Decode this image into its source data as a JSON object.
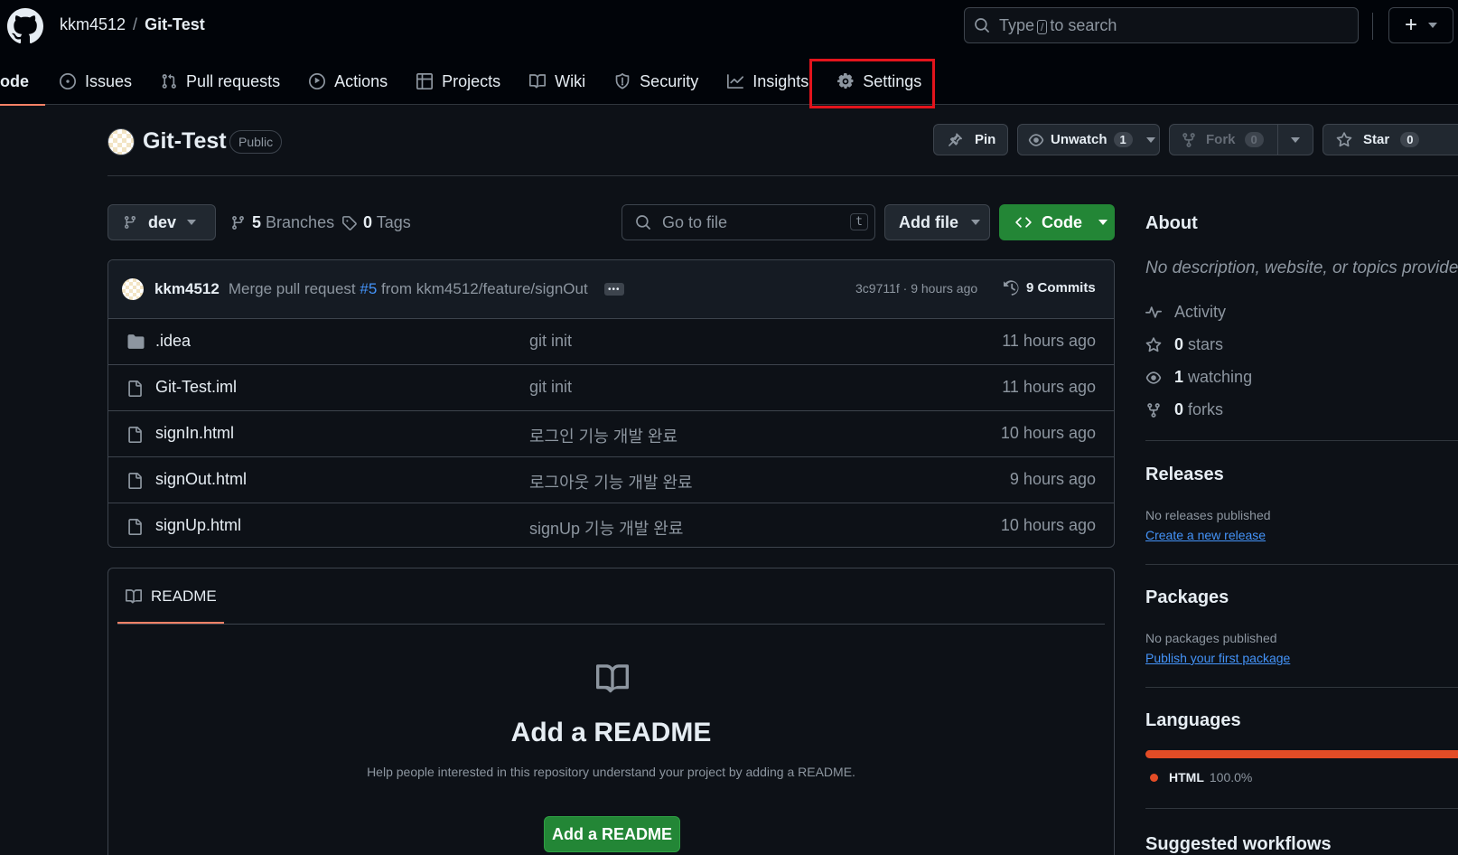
{
  "header": {
    "owner": "kkm4512",
    "separator": "/",
    "repo": "Git-Test",
    "search_pre": "Type",
    "search_key": "/",
    "search_post": "to search",
    "plus_label": "+"
  },
  "nav": {
    "code": "ode",
    "issues": "Issues",
    "pull_requests": "Pull requests",
    "actions": "Actions",
    "projects": "Projects",
    "wiki": "Wiki",
    "security": "Security",
    "insights": "Insights",
    "settings": "Settings"
  },
  "repo_header": {
    "name": "Git-Test",
    "visibility": "Public",
    "pin": "Pin",
    "unwatch": "Unwatch",
    "watch_count": "1",
    "fork": "Fork",
    "fork_count": "0",
    "star": "Star",
    "star_count": "0"
  },
  "file_nav": {
    "branch": "dev",
    "branches_count": "5",
    "branches_label": "Branches",
    "tags_count": "0",
    "tags_label": "Tags",
    "goto_placeholder": "Go to file",
    "goto_key": "t",
    "add_file": "Add file",
    "code": "Code"
  },
  "commit": {
    "author": "kkm4512",
    "msg_pre": "Merge pull request",
    "pr_ref": "#5",
    "msg_post": "from kkm4512/feature/signOut",
    "more": "•••",
    "meta": "3c9711f · 9 hours ago",
    "commits_count": "9",
    "commits_label": "Commits"
  },
  "files": [
    {
      "name": ".idea",
      "type": "folder",
      "message": "git init",
      "time": "11 hours ago"
    },
    {
      "name": "Git-Test.iml",
      "type": "file",
      "message": "git init",
      "time": "11 hours ago"
    },
    {
      "name": "signIn.html",
      "type": "file",
      "message": "로그인 기능 개발 완료",
      "time": "10 hours ago"
    },
    {
      "name": "signOut.html",
      "type": "file",
      "message": "로그아웃 기능 개발 완료",
      "time": "9 hours ago"
    },
    {
      "name": "signUp.html",
      "type": "file",
      "message": "signUp 기능 개발 완료",
      "time": "10 hours ago"
    }
  ],
  "readme": {
    "tab": "README",
    "heading": "Add a README",
    "desc": "Help people interested in this repository understand your project by adding a README.",
    "button": "Add a README"
  },
  "about": {
    "heading": "About",
    "desc": "No description, website, or topics provided.",
    "activity": "Activity",
    "stars_count": "0",
    "stars_label": "stars",
    "watching_count": "1",
    "watching_label": "watching",
    "forks_count": "0",
    "forks_label": "forks"
  },
  "releases": {
    "heading": "Releases",
    "none": "No releases published",
    "link": "Create a new release"
  },
  "packages": {
    "heading": "Packages",
    "none": "No packages published",
    "link": "Publish your first package"
  },
  "languages": {
    "heading": "Languages",
    "items": [
      {
        "name": "HTML",
        "percent": "100.0%",
        "color": "#e34c26"
      }
    ]
  },
  "suggested": {
    "heading": "Suggested workflows"
  },
  "colors": {
    "background": "#0d1117",
    "header_bg": "#010409",
    "accent_green": "#238636",
    "link_blue": "#4493f8",
    "tab_underline": "#f78166",
    "highlight_red": "#e3141c"
  }
}
